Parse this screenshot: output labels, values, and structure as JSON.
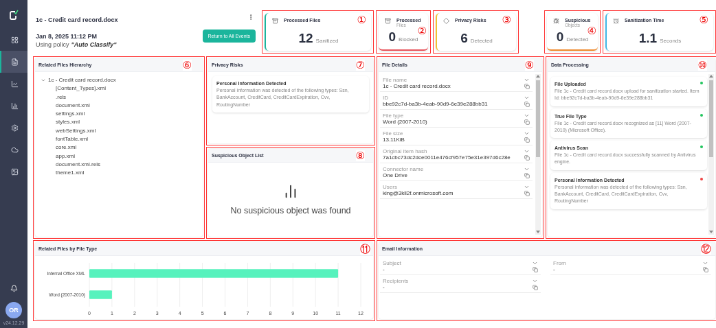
{
  "sidebar": {
    "items": [
      {
        "selected": false
      },
      {
        "selected": true
      },
      {
        "selected": false
      },
      {
        "selected": false
      },
      {
        "selected": false
      },
      {
        "selected": false
      },
      {
        "selected": false
      }
    ],
    "avatar": "OR",
    "version": "v24.12.29"
  },
  "header": {
    "title": "1c - Credit card record.docx",
    "date": "Jan 8, 2025 11:12 PM",
    "policy_prefix": "Using policy",
    "policy": "\"Auto Classify\"",
    "button": "Return to All Events"
  },
  "stats": [
    {
      "title": "Processed Files",
      "value": "12",
      "unit": "Sanitized",
      "color": "#1bb59c",
      "marker": "①"
    },
    {
      "title": "Processed",
      "subtitle": "Files",
      "value": "0",
      "unit": "Blocked",
      "color": "#e8545c",
      "marker": "②"
    },
    {
      "title": "Privacy Risks",
      "value": "6",
      "unit": "Detected",
      "color": "#f2c230",
      "marker": "③"
    },
    {
      "title": "Suspicious",
      "subtitle": "Objects",
      "value": "0",
      "unit": "Detected",
      "color": "#f08a2c",
      "marker": "④"
    },
    {
      "title": "Sanitization Time",
      "value": "1.1",
      "unit": "Seconds",
      "color": "#3fb8e6",
      "marker": "⑤"
    }
  ],
  "hierarchy": {
    "title": "Related Files Hierarchy",
    "marker": "⑥",
    "root": {
      "name": "1c - Credit card record.docx",
      "expanded": true,
      "children": [
        {
          "name": "[Content_Types].xml"
        },
        {
          "name": ".rels"
        },
        {
          "name": "document.xml"
        },
        {
          "name": "settings.xml"
        },
        {
          "name": "styles.xml"
        },
        {
          "name": "webSettings.xml"
        },
        {
          "name": "fontTable.xml"
        },
        {
          "name": "core.xml"
        },
        {
          "name": "app.xml"
        },
        {
          "name": "document.xml.rels"
        },
        {
          "name": "theme1.xml"
        }
      ]
    }
  },
  "privacy_risks": {
    "title": "Privacy Risks",
    "marker": "⑦",
    "items": [
      {
        "title": "Personal Information Detected",
        "text": "Personal information was detected of the following types: Ssn, BankAccount, CreditCard, CreditCardExpiration, Cvv, RoutingNumber"
      }
    ]
  },
  "suspicious": {
    "title": "Suspicious Object List",
    "marker": "⑧",
    "empty": "No suspicious object was found"
  },
  "file_details": {
    "title": "File Details",
    "marker": "⑨",
    "fields": [
      {
        "label": "File name",
        "value": "1c - Credit card record.docx"
      },
      {
        "label": "ID",
        "value": "bbe92c7d-ba3b-4eab-90d9-6e39e288bb31"
      },
      {
        "label": "File type",
        "value": "Word (2007-2010)"
      },
      {
        "label": "File size",
        "value": "13.11KiB"
      },
      {
        "label": "Original item hash",
        "value": "7a1cbc73dc2dce0011e476cf957e75e31e397d6c28e"
      },
      {
        "label": "Connector name",
        "value": "One Drive"
      },
      {
        "label": "Users",
        "value": "king@3kll2f.onmicrosoft.com"
      }
    ]
  },
  "data_processing": {
    "title": "Data Processing",
    "marker": "⑩",
    "events": [
      {
        "title": "File Uploaded",
        "text": "File 1c - Credit card record.docx upload for sanitization started. Item Id: bbe92c7d-ba3b-4eab-90d9-6e39e288bb31",
        "color": "#22c55e"
      },
      {
        "title": "True File Type",
        "text": "File 1c - Credit card record.docx recognized as [11] Word (2007-2010) (Microsoft Office).",
        "color": "#22c55e"
      },
      {
        "title": "Antivirus Scan",
        "text": "File 1c - Credit card record.docx successfully scanned by Antivirus engine.",
        "color": "#22c55e"
      },
      {
        "title": "Personal Information Detected",
        "text": "Personal information was detected of the following types: Ssn, BankAccount, CreditCard, CreditCardExpiration, Cvv, RoutingNumber",
        "color": "#ef4444"
      }
    ]
  },
  "file_type_chart": {
    "title": "Related Files by File Type",
    "marker": "⑪",
    "chart_data": {
      "type": "bar",
      "orientation": "horizontal",
      "categories": [
        "Internal Office XML",
        "Word (2007-2010)"
      ],
      "series": [
        {
          "color": "#57f2bd",
          "values": [
            11,
            1
          ]
        }
      ],
      "grid": true,
      "xlim": [
        0,
        12
      ],
      "xticks": [
        0,
        1,
        2,
        3,
        4,
        5,
        6,
        7,
        8,
        9,
        10,
        11,
        12
      ]
    }
  },
  "email": {
    "title": "Email Information",
    "marker": "⑫",
    "fields": [
      {
        "label": "Subject",
        "value": "-"
      },
      {
        "label": "From",
        "value": "-"
      },
      {
        "label": "Recipients",
        "value": "-"
      }
    ]
  }
}
